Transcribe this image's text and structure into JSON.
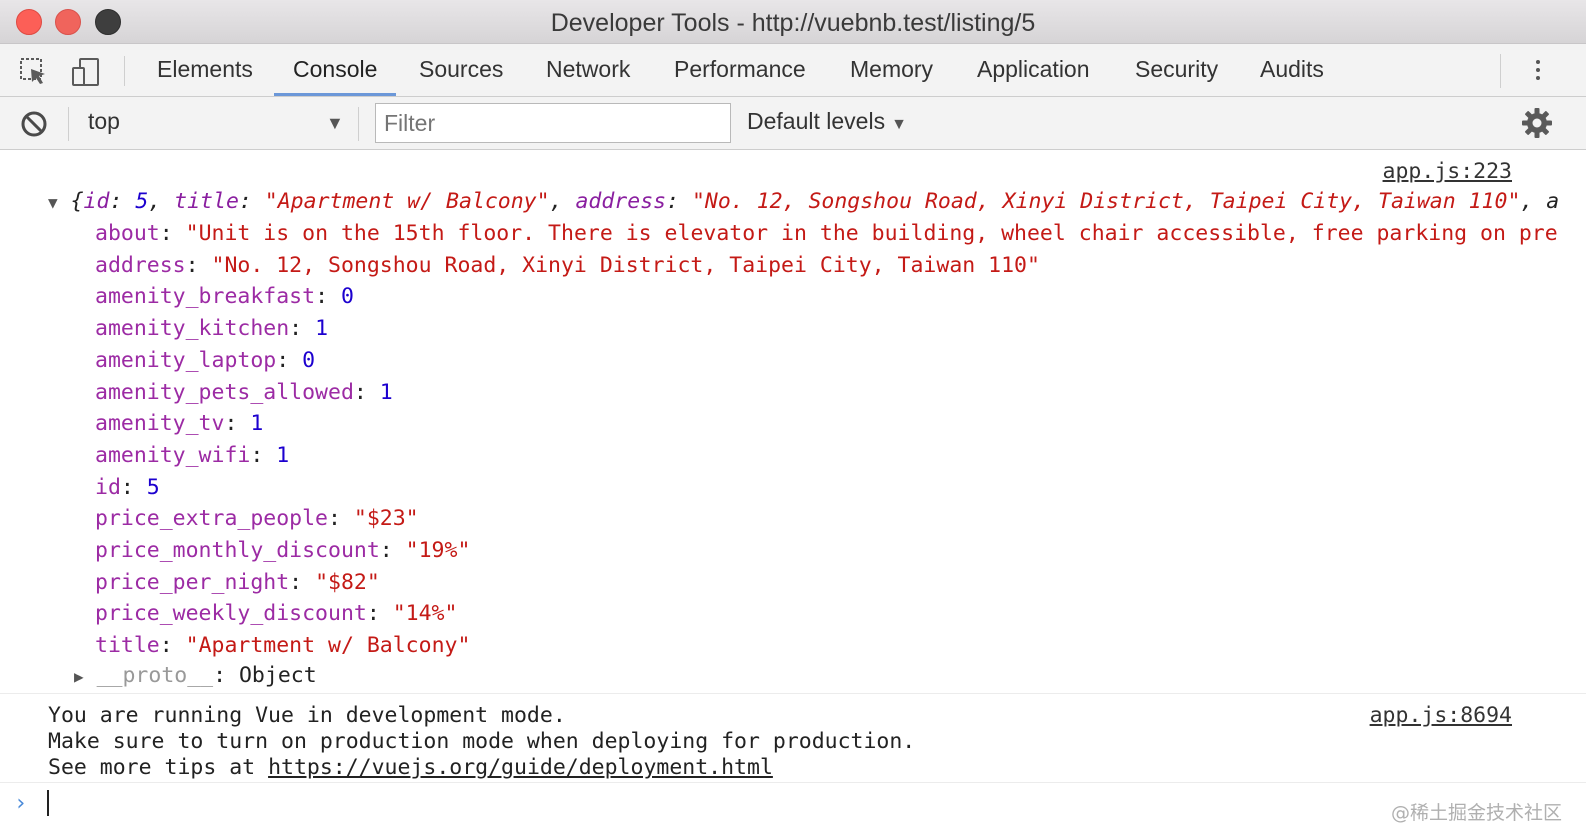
{
  "window": {
    "title": "Developer Tools - http://vuebnb.test/listing/5"
  },
  "tabs": [
    "Elements",
    "Console",
    "Sources",
    "Network",
    "Performance",
    "Memory",
    "Application",
    "Security",
    "Audits"
  ],
  "active_tab": "Console",
  "toolbar": {
    "context": "top",
    "filter_placeholder": "Filter",
    "levels": "Default levels"
  },
  "console": {
    "object_message": {
      "source": "app.js:223",
      "summary": {
        "open": "{",
        "id_key": "id",
        "id_val": "5",
        "title_key": "title",
        "title_val": "\"Apartment w/ Balcony\"",
        "address_key": "address",
        "address_val": "\"No. 12, Songshou Road, Xinyi District, Taipei City, Taiwan 110\"",
        "tail": ", a"
      },
      "properties": [
        {
          "key": "about",
          "value": "\"Unit is on the 15th floor. There is elevator in the building, wheel chair accessible, free parking on pre",
          "type": "str"
        },
        {
          "key": "address",
          "value": "\"No. 12, Songshou Road, Xinyi District, Taipei City, Taiwan 110\"",
          "type": "str"
        },
        {
          "key": "amenity_breakfast",
          "value": "0",
          "type": "num"
        },
        {
          "key": "amenity_kitchen",
          "value": "1",
          "type": "num"
        },
        {
          "key": "amenity_laptop",
          "value": "0",
          "type": "num"
        },
        {
          "key": "amenity_pets_allowed",
          "value": "1",
          "type": "num"
        },
        {
          "key": "amenity_tv",
          "value": "1",
          "type": "num"
        },
        {
          "key": "amenity_wifi",
          "value": "1",
          "type": "num"
        },
        {
          "key": "id",
          "value": "5",
          "type": "num"
        },
        {
          "key": "price_extra_people",
          "value": "\"$23\"",
          "type": "str"
        },
        {
          "key": "price_monthly_discount",
          "value": "\"19%\"",
          "type": "str"
        },
        {
          "key": "price_per_night",
          "value": "\"$82\"",
          "type": "str"
        },
        {
          "key": "price_weekly_discount",
          "value": "\"14%\"",
          "type": "str"
        },
        {
          "key": "title",
          "value": "\"Apartment w/ Balcony\"",
          "type": "str"
        }
      ],
      "proto_key": "__proto__",
      "proto_val": "Object"
    },
    "vue_message": {
      "source": "app.js:8694",
      "line1": "You are running Vue in development mode.",
      "line2": "Make sure to turn on production mode when deploying for production.",
      "line3_prefix": "See more tips at ",
      "line3_link": "https://vuejs.org/guide/deployment.html"
    }
  },
  "watermark": "@稀土掘金技术社区"
}
